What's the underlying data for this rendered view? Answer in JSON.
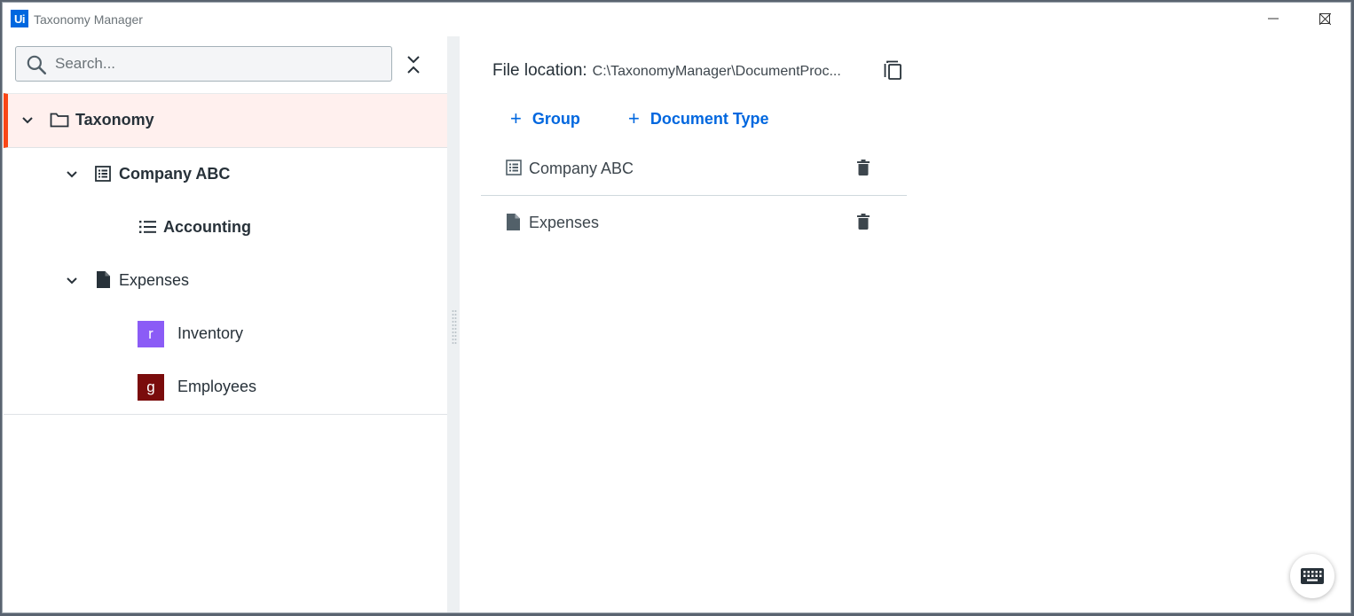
{
  "window": {
    "app_logo_text": "Ui",
    "title": "Taxonomy Manager"
  },
  "left": {
    "search": {
      "placeholder": "Search...",
      "value": ""
    },
    "tree": {
      "root": {
        "label": "Taxonomy",
        "icon": "folder-icon",
        "expanded": true,
        "selected": true
      },
      "group": {
        "label": "Company ABC",
        "icon": "group-icon",
        "expanded": true
      },
      "category": {
        "label": "Accounting",
        "icon": "list-icon"
      },
      "doc_type": {
        "label": "Expenses",
        "icon": "document-icon",
        "expanded": true
      },
      "fields": [
        {
          "badge": "r",
          "label": "Inventory",
          "color": "#8b5cf6"
        },
        {
          "badge": "g",
          "label": "Employees",
          "color": "#7a0c0c"
        }
      ]
    }
  },
  "right": {
    "file_location_label": "File location:",
    "file_location_path": "C:\\TaxonomyManager\\DocumentProc...",
    "add_group_label": "Group",
    "add_doctype_label": "Document Type",
    "items": [
      {
        "label": "Company ABC",
        "icon": "group-icon"
      },
      {
        "label": "Expenses",
        "icon": "document-icon"
      }
    ]
  },
  "colors": {
    "accent": "#0067df",
    "selection": "#fa4616",
    "selection_bg": "#fff0ee"
  }
}
